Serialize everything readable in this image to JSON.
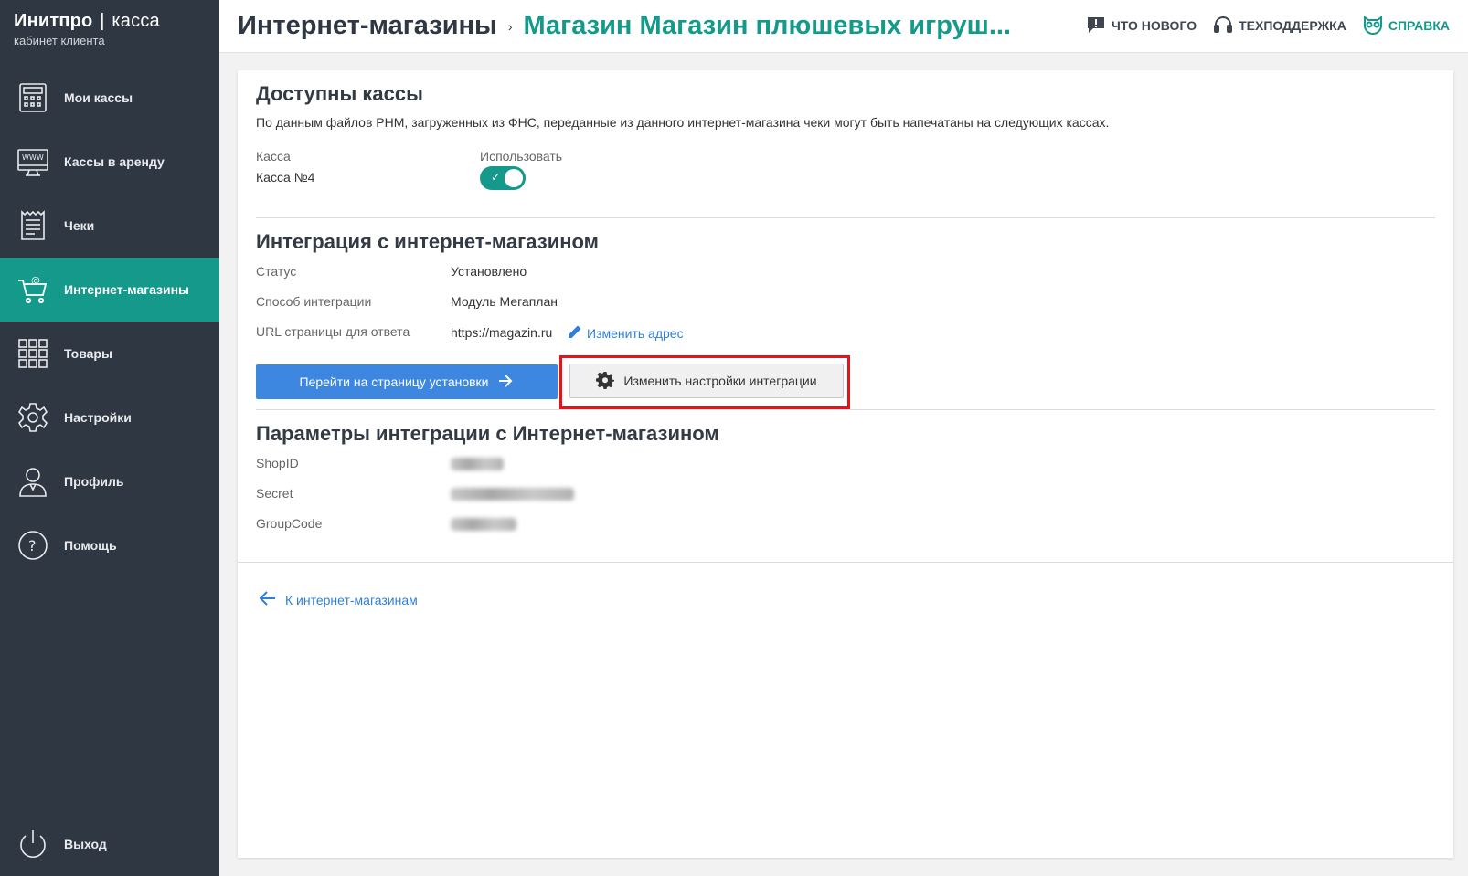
{
  "brand": {
    "name": "Инитпро",
    "separator": "|",
    "product": "касса",
    "subtitle": "кабинет клиента"
  },
  "sidebar": {
    "items": [
      {
        "label": "Мои кассы",
        "icon": "cash-register-icon",
        "active": false
      },
      {
        "label": "Кассы в аренду",
        "icon": "www-monitor-icon",
        "active": false
      },
      {
        "label": "Чеки",
        "icon": "receipt-icon",
        "active": false
      },
      {
        "label": "Интернет-магазины",
        "icon": "shopping-cart-icon",
        "active": true
      },
      {
        "label": "Товары",
        "icon": "grid-icon",
        "active": false
      },
      {
        "label": "Настройки",
        "icon": "gear-icon",
        "active": false
      },
      {
        "label": "Профиль",
        "icon": "user-icon",
        "active": false
      },
      {
        "label": "Помощь",
        "icon": "question-icon",
        "active": false
      }
    ],
    "logout": {
      "label": "Выход",
      "icon": "power-icon"
    }
  },
  "header": {
    "breadcrumb_root": "Интернет-магазины",
    "breadcrumb_sep": "›",
    "breadcrumb_current": "Магазин Магазин плюшевых игруш...",
    "links": [
      {
        "label": "Что нового",
        "icon": "chat-alert-icon"
      },
      {
        "label": "Техподдержка",
        "icon": "headset-icon"
      },
      {
        "label": "Справка",
        "icon": "owl-icon"
      }
    ]
  },
  "colors": {
    "accent": "#14998a",
    "sidebar_bg": "#2f3743",
    "primary_button": "#3d87e0",
    "link": "#2f7fd9",
    "highlight": "#e8121a"
  },
  "cashboxes": {
    "title": "Доступны кассы",
    "description": "По данным файлов РНМ, загруженных из ФНС, переданные из данного интернет-магазина чеки могут быть напечатаны на следующих кассах.",
    "col_kassa": "Касса",
    "col_use": "Использовать",
    "rows": [
      {
        "name": "Касса №4",
        "enabled": true
      }
    ]
  },
  "integration": {
    "title": "Интеграция с интернет-магазином",
    "status_label": "Статус",
    "status_value": "Установлено",
    "method_label": "Способ интеграции",
    "method_value": "Модуль Мегаплан",
    "url_label": "URL страницы для ответа",
    "url_value": "https://magazin.ru",
    "change_address": "Изменить адрес",
    "install_button": "Перейти на страницу установки",
    "settings_button": "Изменить настройки интеграции"
  },
  "params": {
    "title": "Параметры интеграции с Интернет-магазином",
    "shopid_label": "ShopID",
    "secret_label": "Secret",
    "groupcode_label": "GroupCode"
  },
  "back_link": "К интернет-магазинам"
}
